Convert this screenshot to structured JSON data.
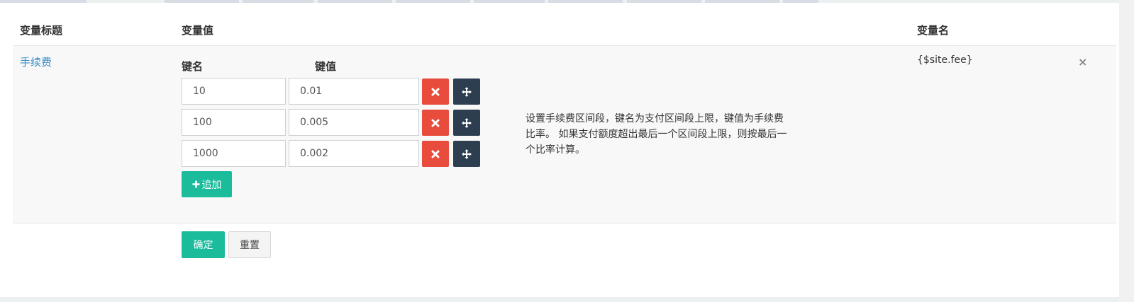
{
  "table": {
    "headers": {
      "title": "变量标题",
      "value": "变量值",
      "name": "变量名"
    },
    "row": {
      "title": "手续费",
      "kv_headers": {
        "key": "键名",
        "value": "键值"
      },
      "pairs": [
        {
          "key": "10",
          "value": "0.01"
        },
        {
          "key": "100",
          "value": "0.005"
        },
        {
          "key": "1000",
          "value": "0.002"
        }
      ],
      "add_label": "追加",
      "description": "设置手续费区间段，键名为支付区间段上限，键值为手续费比率。 如果支付额度超出最后一个区间段上限，则按最后一个比率计算。",
      "var_name": "{$site.fee}",
      "remove_row_icon": "×"
    }
  },
  "form": {
    "confirm_label": "确定",
    "reset_label": "重置"
  },
  "icons": {
    "delete": "close-icon",
    "move": "move-arrows-icon",
    "add": "plus-icon"
  },
  "colors": {
    "primary": "#1abc9c",
    "danger": "#e74c3c",
    "dark": "#2c3e50",
    "link": "#3a8fc7"
  }
}
